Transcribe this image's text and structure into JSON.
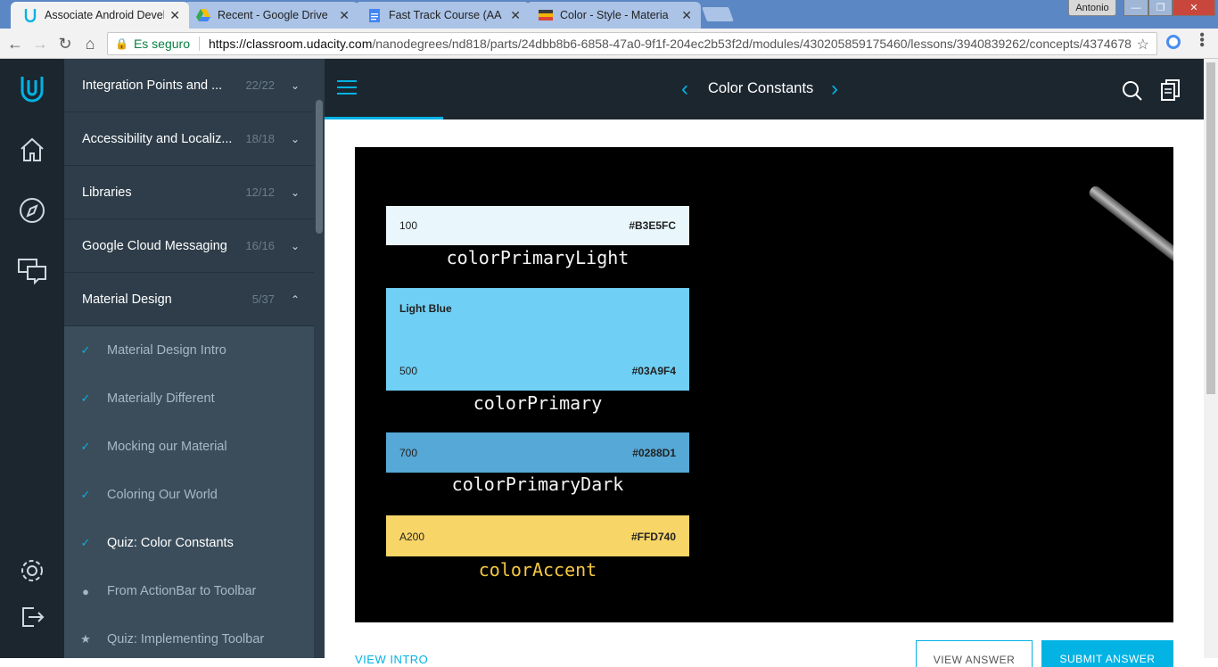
{
  "browser": {
    "tabs": [
      {
        "title": "Associate Android Devel",
        "active": true
      },
      {
        "title": "Recent - Google Drive",
        "active": false
      },
      {
        "title": "Fast Track Course (AA",
        "active": false
      },
      {
        "title": "Color - Style - Materia",
        "active": false
      }
    ],
    "user": "Antonio",
    "secure_label": "Es seguro",
    "url_host": "https://classroom.udacity.com",
    "url_path": "/nanodegrees/nd818/parts/24dbb8b6-6858-47a0-9f1f-204ec2b53f2d/modules/430205859175460/lessons/3940839262/concepts/4374678"
  },
  "sidebar": {
    "lessons": [
      {
        "label": "Integration Points and ...",
        "count": "22/22"
      },
      {
        "label": "Accessibility and Localiz...",
        "count": "18/18"
      },
      {
        "label": "Libraries",
        "count": "12/12"
      },
      {
        "label": "Google Cloud Messaging",
        "count": "16/16"
      },
      {
        "label": "Material Design",
        "count": "5/37"
      }
    ],
    "concepts": [
      {
        "label": "Material Design Intro",
        "mark": "✓"
      },
      {
        "label": "Materially Different",
        "mark": "✓"
      },
      {
        "label": "Mocking our Material",
        "mark": "✓"
      },
      {
        "label": "Coloring Our World",
        "mark": "✓"
      },
      {
        "label": "Quiz: Color Constants",
        "mark": "✓"
      },
      {
        "label": "From ActionBar to Toolbar",
        "mark": "●"
      },
      {
        "label": "Quiz: Implementing Toolbar",
        "mark": "★"
      }
    ]
  },
  "header": {
    "title": "Color Constants"
  },
  "video": {
    "swatches": [
      {
        "value": "100",
        "hex": "#B3E5FC",
        "name": "colorPrimaryLight"
      },
      {
        "label": "Light Blue",
        "value": "500",
        "hex": "#03A9F4",
        "name": "colorPrimary"
      },
      {
        "value": "700",
        "hex": "#0288D1",
        "name": "colorPrimaryDark"
      },
      {
        "value": "A200",
        "hex": "#FFD740",
        "name": "colorAccent"
      }
    ]
  },
  "actions": {
    "view_intro": "VIEW INTRO",
    "view_answer": "VIEW ANSWER",
    "submit_answer": "SUBMIT ANSWER"
  },
  "colors": {
    "accent": "#02b3e4",
    "rail": "#1c262f",
    "sidebar": "#2e3d49"
  }
}
